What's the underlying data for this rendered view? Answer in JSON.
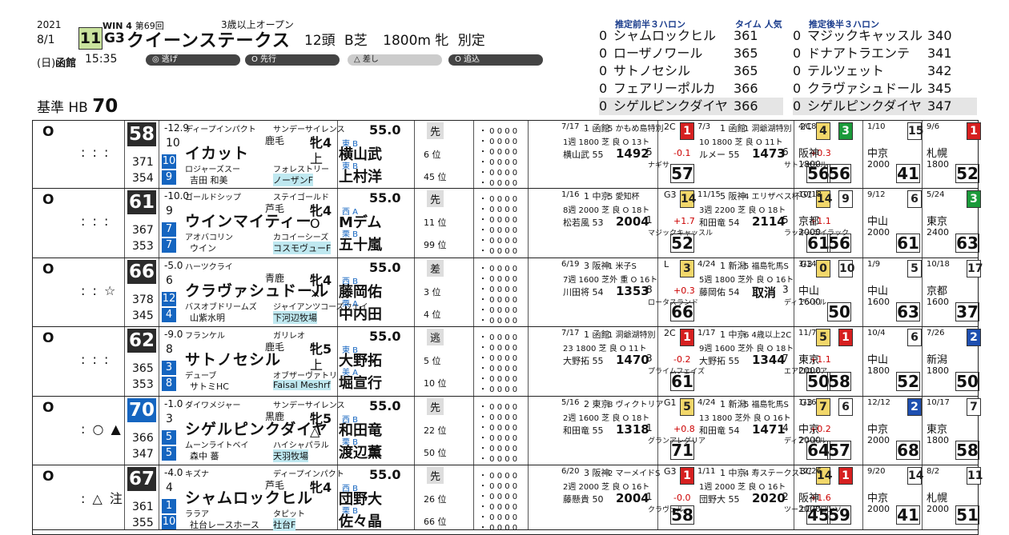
{
  "header": {
    "year": "2021",
    "date": "8/1",
    "weekday": "(日)",
    "venue": "函館",
    "post_time": "15:35",
    "win": "WIN 4",
    "kai": "第69回",
    "race_no": "11",
    "grade": "G3",
    "race_name": "クイーンステークス",
    "condition": "3歳以上オープン",
    "field": "12頭",
    "course": "B芝",
    "distance": "1800m",
    "sex": "牝",
    "weight_rule": "別定",
    "styles": [
      "◎ 逃げ",
      "O 先行",
      "△ 差し",
      "O 追込"
    ],
    "kijun_label": "基準 HB",
    "kijun_value": "70"
  },
  "rank_front": {
    "title": "推定前半３ハロン",
    "time_label": "タイム 人気",
    "items": [
      {
        "mark": "0",
        "name": "シャムロックヒル",
        "time": "361"
      },
      {
        "mark": "0",
        "name": "ローザノワール",
        "time": "365"
      },
      {
        "mark": "0",
        "name": "サトノセシル",
        "time": "365"
      },
      {
        "mark": "0",
        "name": "フェアリーポルカ",
        "time": "366"
      },
      {
        "mark": "0",
        "name": "シゲルピンクダイヤ",
        "time": "366"
      }
    ]
  },
  "rank_back": {
    "title": "推定後半３ハロン",
    "items": [
      {
        "mark": "0",
        "name": "マジックキャッスル",
        "time": "340"
      },
      {
        "mark": "0",
        "name": "ドナアトラエンテ",
        "time": "341"
      },
      {
        "mark": "0",
        "name": "テルツェット",
        "time": "342"
      },
      {
        "mark": "0",
        "name": "クラヴァシュドール",
        "time": "345"
      },
      {
        "mark": "0",
        "name": "シゲルピンクダイヤ",
        "time": "347"
      }
    ]
  },
  "horses": [
    {
      "mark": "O",
      "tri": ": : :",
      "hb": "58",
      "hb_color": "#2b2b2b",
      "diff": "-12.9",
      "diff2": "10",
      "v1": "371",
      "v2": "354",
      "r1": "10",
      "r2": "9",
      "sire": "ディープインパクト",
      "dam_sire": "サンデーサイレンス",
      "coat": "鹿毛",
      "sex_age": "牝4",
      "name": "イカット",
      "pos": "上",
      "dam": "ロジャーズスー",
      "dam_sire2": "フォレストリー",
      "owner": "吉田 和美",
      "breeder": "ノーザンF",
      "weight": "55.0",
      "style": "先",
      "jockey": "横山武",
      "jockey_loc": "東 B",
      "pos_num": "6",
      "trainer": "上村洋",
      "trainer_loc": "東 B",
      "trainer_num": "45",
      "waku_color": "#ffffff",
      "waku": "1"
    },
    {
      "mark": "O",
      "tri": ": : :",
      "hb": "61",
      "hb_color": "#2b2b2b",
      "diff": "-10.0",
      "diff2": "9",
      "v1": "367",
      "v2": "353",
      "r1": "7",
      "r2": "7",
      "sire": "ゴールドシップ",
      "dam_sire": "ステイゴールド",
      "coat": "芦毛",
      "sex_age": "牝4",
      "name": "ウインマイティー",
      "pos": "O",
      "dam": "アオバコリン",
      "dam_sire2": "カコイーシーズ",
      "owner": "ウイン",
      "breeder": "コスモヴューF",
      "weight": "55.0",
      "style": "先",
      "jockey": "Mデム",
      "jockey_loc": "西 A",
      "pos_num": "11",
      "trainer": "五十嵐",
      "trainer_loc": "栗 B",
      "trainer_num": "99",
      "waku_color": "#ffffff",
      "waku": "2"
    },
    {
      "mark": "O",
      "tri": ": : ☆",
      "hb": "66",
      "hb_color": "#2b2b2b",
      "diff": "-5.0",
      "diff2": "6",
      "v1": "378",
      "v2": "345",
      "r1": "12",
      "r2": "4",
      "sire": "ハーツクライ",
      "dam_sire": "",
      "coat": "青鹿",
      "sex_age": "牝4",
      "name": "クラヴァシュドール",
      "pos": "×",
      "dam": "バスオブドリームズ",
      "dam_sire2": "ジャイアンツコーズウェイ",
      "owner": "山紫水明",
      "breeder": "下河辺牧場",
      "weight": "55.0",
      "style": "差",
      "jockey": "藤岡佑",
      "jockey_loc": "西 B",
      "pos_num": "3",
      "trainer": "中内田",
      "trainer_loc": "栗 A",
      "trainer_num": "4",
      "waku_color": "#ffffff",
      "waku": "3"
    },
    {
      "mark": "O",
      "tri": ": : :",
      "hb": "62",
      "hb_color": "#2b2b2b",
      "diff": "-9.0",
      "diff2": "8",
      "v1": "365",
      "v2": "353",
      "r1": "3",
      "r2": "8",
      "sire": "フランケル",
      "dam_sire": "ガリレオ",
      "coat": "鹿毛",
      "sex_age": "牝5",
      "name": "サトノセシル",
      "pos": "上",
      "dam": "デューブ",
      "dam_sire2": "オブザーヴァトリ",
      "owner": "サトミHC",
      "breeder": "Faisal Meshrf",
      "weight": "55.0",
      "style": "逃",
      "jockey": "大野拓",
      "jockey_loc": "東 B",
      "pos_num": "5",
      "trainer": "堀宣行",
      "trainer_loc": "美 A",
      "trainer_num": "10",
      "waku_color": "#ffffff",
      "waku": "4"
    },
    {
      "mark": "O",
      "tri": ": ○ ▲",
      "hb": "70",
      "hb_color": "#1565c0",
      "diff": "-1.0",
      "diff2": "3",
      "v1": "366",
      "v2": "347",
      "r1": "5",
      "r2": "5",
      "sire": "ダイワメジャー",
      "dam_sire": "サンデーサイレンス",
      "coat": "黒鹿",
      "sex_age": "牝5",
      "name": "シゲルピンクダイヤ",
      "pos": "△",
      "dam": "ムーンライトベイ",
      "dam_sire2": "ハイシャパラル",
      "owner": "森中 蕃",
      "breeder": "天羽牧場",
      "weight": "55.0",
      "style": "先",
      "jockey": "和田竜",
      "jockey_loc": "西 B",
      "pos_num": "22",
      "trainer": "渡辺薫",
      "trainer_loc": "栗 B",
      "trainer_num": "50",
      "waku_color": "#ffffff",
      "waku": "5"
    },
    {
      "mark": "O",
      "tri": ": △ 注",
      "hb": "67",
      "hb_color": "#2b2b2b",
      "diff": "-4.0",
      "diff2": "4",
      "v1": "361",
      "v2": "355",
      "r1": "1",
      "r2": "10",
      "sire": "キズナ",
      "dam_sire": "ディープインパクト",
      "coat": "芦毛",
      "sex_age": "牝4",
      "name": "シャムロックヒル",
      "pos": "",
      "dam": "ララア",
      "dam_sire2": "タピット",
      "owner": "社台レースホース",
      "breeder": "社台F",
      "weight": "55.0",
      "style": "先",
      "jockey": "団野大",
      "jockey_loc": "西 B",
      "pos_num": "26",
      "trainer": "佐々晶",
      "trainer_loc": "栗 B",
      "trainer_num": "66",
      "waku_color": "#ffffff",
      "waku": "6"
    }
  ],
  "past": [
    [
      {
        "date": "7/17",
        "venue": "1 函館",
        "race": "5 かもめ島特別",
        "field": "2C",
        "place": "1",
        "course": "1週 1800 芝 良 O 13ト",
        "jockey": "横山武 55",
        "time": "1492",
        "pos": "5",
        "diff": "-0.1",
        "note": "ナギサ",
        "spd": "57"
      },
      {
        "date": "7/3",
        "venue": "1 函館",
        "race": "1 洞爺湖特別",
        "field": "2C",
        "place": "4",
        "course": "10 1800 芝 良 O 11ト",
        "jockey": "ルメー 55",
        "time": "1473",
        "pos": "6",
        "diff": "+0.3",
        "note": "サトノセシル",
        "spd": "56"
      },
      {
        "date": "4/18",
        "venue": "阪神",
        "race": "",
        "field": "",
        "place": "3",
        "course": "1800",
        "jockey": "",
        "time": "",
        "pos": "",
        "diff": "",
        "note": "",
        "spd": "56"
      },
      {
        "date": "1/10",
        "venue": "中京",
        "race": "",
        "field": "",
        "place": "15",
        "course": "2000",
        "jockey": "",
        "time": "",
        "pos": "",
        "diff": "",
        "note": "",
        "spd": "41"
      },
      {
        "date": "9/6",
        "venue": "札幌",
        "race": "",
        "field": "",
        "place": "1",
        "course": "1800",
        "jockey": "",
        "time": "",
        "pos": "",
        "diff": "",
        "note": "",
        "spd": "52"
      }
    ],
    [
      {
        "date": "1/16",
        "venue": "1 中京",
        "race": "5 愛知杯",
        "field": "G3",
        "place": "14",
        "course": "8週 2000 芝 良 O 18ト",
        "jockey": "松若風 53",
        "time": "2004",
        "pos": "1",
        "diff": "+1.7",
        "note": "マジックキャッスル",
        "spd": "52"
      },
      {
        "date": "11/15",
        "venue": "5 阪神",
        "race": "4 エリザベス杯",
        "field": "G1",
        "place": "14",
        "course": "3週 2200 芝 良 O 18ト",
        "jockey": "和田竜 54",
        "time": "2114",
        "pos": "5",
        "diff": "+1.1",
        "note": "ラッキーライラック",
        "spd": "61"
      },
      {
        "date": "10/18",
        "venue": "京都",
        "race": "",
        "field": "",
        "place": "9",
        "course": "2000",
        "jockey": "",
        "time": "",
        "pos": "",
        "diff": "",
        "note": "",
        "spd": "56"
      },
      {
        "date": "9/12",
        "venue": "中山",
        "race": "",
        "field": "",
        "place": "6",
        "course": "2000",
        "jockey": "",
        "time": "",
        "pos": "",
        "diff": "",
        "note": "",
        "spd": "61"
      },
      {
        "date": "5/24",
        "venue": "東京",
        "race": "",
        "field": "",
        "place": "3",
        "course": "2400",
        "jockey": "",
        "time": "",
        "pos": "",
        "diff": "",
        "note": "",
        "spd": "63"
      }
    ],
    [
      {
        "date": "6/19",
        "venue": "3 阪神",
        "race": "1 米子S",
        "field": "L",
        "place": "3",
        "course": "7週 1600 芝外 重 O 16ト",
        "jockey": "川田将 54",
        "time": "1353",
        "pos": "8",
        "diff": "+0.3",
        "note": "ロータスランド",
        "spd": "66"
      },
      {
        "date": "4/24",
        "venue": "1 新潟",
        "race": "5 福島牝馬S",
        "field": "G3",
        "place": "0",
        "course": "5週 1800 芝外 良 O 16ト",
        "jockey": "藤岡佑 54",
        "time": "取消",
        "pos": "3",
        "diff": "",
        "note": "ディアンドル",
        "spd": ""
      },
      {
        "date": "3/14",
        "venue": "中山",
        "race": "",
        "field": "",
        "place": "10",
        "course": "1600",
        "jockey": "",
        "time": "",
        "pos": "",
        "diff": "",
        "note": "",
        "spd": "50"
      },
      {
        "date": "1/9",
        "venue": "中山",
        "race": "",
        "field": "",
        "place": "5",
        "course": "1600",
        "jockey": "",
        "time": "",
        "pos": "",
        "diff": "",
        "note": "",
        "spd": "63"
      },
      {
        "date": "10/18",
        "venue": "京都",
        "race": "",
        "field": "",
        "place": "17",
        "course": "1600",
        "jockey": "",
        "time": "",
        "pos": "",
        "diff": "",
        "note": "",
        "spd": "37"
      }
    ],
    [
      {
        "date": "7/17",
        "venue": "1 函館",
        "race": "1 洞爺湖特別",
        "field": "2C",
        "place": "1",
        "course": "23 1800 芝 良 O 11ト",
        "jockey": "大野拓 55",
        "time": "1470",
        "pos": "3",
        "diff": "-0.2",
        "note": "プライムフェイズ",
        "spd": "61"
      },
      {
        "date": "1/17",
        "venue": "1 中京",
        "race": "6 4歳以上2C",
        "field": "",
        "place": "5",
        "course": "9週 1600 芝外 良 O 18ト",
        "jockey": "大野拓 55",
        "time": "1344",
        "pos": "7",
        "diff": "+1.1",
        "note": "エアロロノア",
        "spd": "50"
      },
      {
        "date": "11/7",
        "venue": "東京",
        "race": "",
        "field": "",
        "place": "1",
        "course": "2000",
        "jockey": "",
        "time": "",
        "pos": "",
        "diff": "",
        "note": "",
        "spd": "58"
      },
      {
        "date": "10/4",
        "venue": "中山",
        "race": "",
        "field": "",
        "place": "6",
        "course": "1800",
        "jockey": "",
        "time": "",
        "pos": "",
        "diff": "",
        "note": "",
        "spd": "52"
      },
      {
        "date": "7/26",
        "venue": "新潟",
        "race": "",
        "field": "",
        "place": "2",
        "course": "1800",
        "jockey": "",
        "time": "",
        "pos": "",
        "diff": "",
        "note": "",
        "spd": "50"
      }
    ],
    [
      {
        "date": "5/16",
        "venue": "2 東京",
        "race": "8 ヴィクトリア",
        "field": "G1",
        "place": "5",
        "course": "2週 1600 芝 良 O 18ト",
        "jockey": "和田竜 55",
        "time": "1318",
        "pos": "1",
        "diff": "+0.8",
        "note": "グランアレグリア",
        "spd": "71"
      },
      {
        "date": "4/24",
        "venue": "1 新潟",
        "race": "5 福島牝馬S",
        "field": "G3",
        "place": "7",
        "course": "13 1800 芝外 良 O 16ト",
        "jockey": "和田竜 54",
        "time": "1471",
        "pos": "4",
        "diff": "+0.2",
        "note": "ディアンドル",
        "spd": "64"
      },
      {
        "date": "1/16",
        "venue": "中京",
        "race": "",
        "field": "",
        "place": "6",
        "course": "2000",
        "jockey": "",
        "time": "",
        "pos": "",
        "diff": "",
        "note": "",
        "spd": "57"
      },
      {
        "date": "12/12",
        "venue": "中京",
        "race": "",
        "field": "",
        "place": "2",
        "course": "2000",
        "jockey": "",
        "time": "",
        "pos": "",
        "diff": "",
        "note": "",
        "spd": "68"
      },
      {
        "date": "10/17",
        "venue": "東京",
        "race": "",
        "field": "",
        "place": "7",
        "course": "1800",
        "jockey": "",
        "time": "",
        "pos": "",
        "diff": "",
        "note": "",
        "spd": "58"
      }
    ],
    [
      {
        "date": "6/20",
        "venue": "3 阪神",
        "race": "2 マーメイドS",
        "field": "G3",
        "place": "1",
        "course": "2週 2000 芝 良 O 16ト",
        "jockey": "藤懸貴 50",
        "time": "2004",
        "pos": "1",
        "diff": "-0.0",
        "note": "クラヴェル",
        "spd": "58"
      },
      {
        "date": "1/11",
        "venue": "1 中京",
        "race": "4 寿ステークス",
        "field": "3C",
        "place": "14",
        "course": "1週 2000 芝 良 O 16ト",
        "jockey": "団野大 55",
        "time": "2020",
        "pos": "2",
        "diff": "+1.6",
        "note": "ツーエムアロンソ",
        "spd": "45"
      },
      {
        "date": "12/26",
        "venue": "阪神",
        "race": "",
        "field": "",
        "place": "1",
        "course": "2000",
        "jockey": "",
        "time": "",
        "pos": "",
        "diff": "",
        "note": "",
        "spd": "59"
      },
      {
        "date": "9/20",
        "venue": "中京",
        "race": "",
        "field": "",
        "place": "14",
        "course": "2000",
        "jockey": "",
        "time": "",
        "pos": "",
        "diff": "",
        "note": "",
        "spd": "41"
      },
      {
        "date": "8/2",
        "venue": "札幌",
        "race": "",
        "field": "",
        "place": "11",
        "course": "2000",
        "jockey": "",
        "time": "",
        "pos": "",
        "diff": "",
        "note": "",
        "spd": "51"
      }
    ]
  ]
}
